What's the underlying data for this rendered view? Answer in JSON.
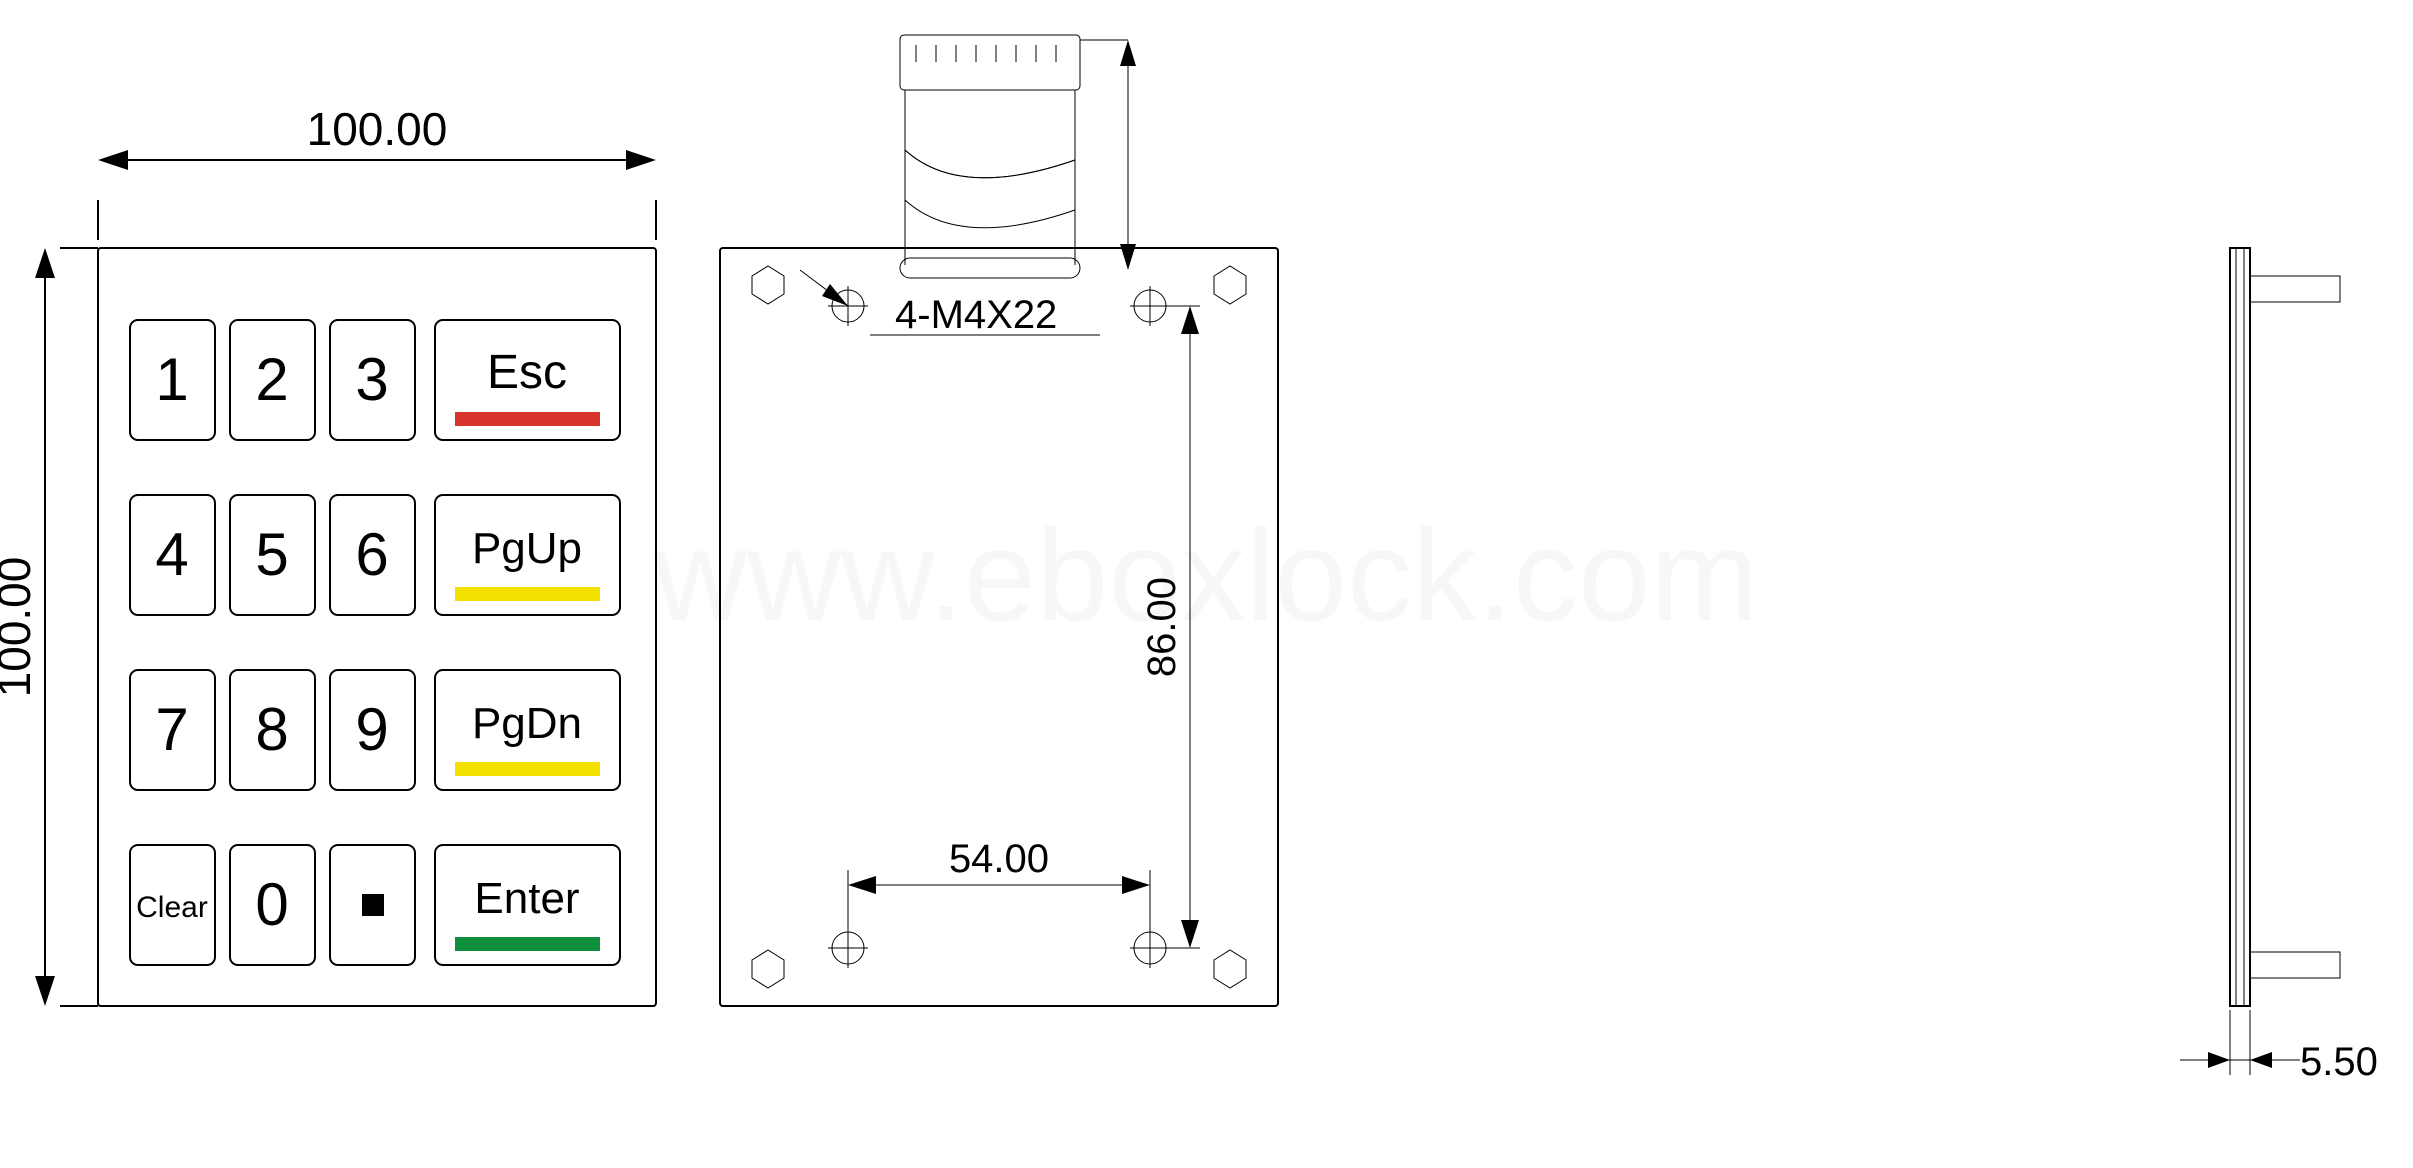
{
  "dims": {
    "width_top": "100.00",
    "height_left": "100.00",
    "screw_spec": "4-M4X22",
    "back_hole_h": "54.00",
    "back_hole_v": "86.00",
    "side_depth": "5.50"
  },
  "keys": {
    "r0": [
      "1",
      "2",
      "3",
      "Esc"
    ],
    "r1": [
      "4",
      "5",
      "6",
      "PgUp"
    ],
    "r2": [
      "7",
      "8",
      "9",
      "PgDn"
    ],
    "r3": [
      "Clear",
      "0",
      "■",
      "Enter"
    ]
  },
  "colors": {
    "esc": "#d9342b",
    "pgup": "#f4e000",
    "pgdn": "#f4e000",
    "enter": "#0f8f3c"
  },
  "watermark": "www.eboxlock.com"
}
